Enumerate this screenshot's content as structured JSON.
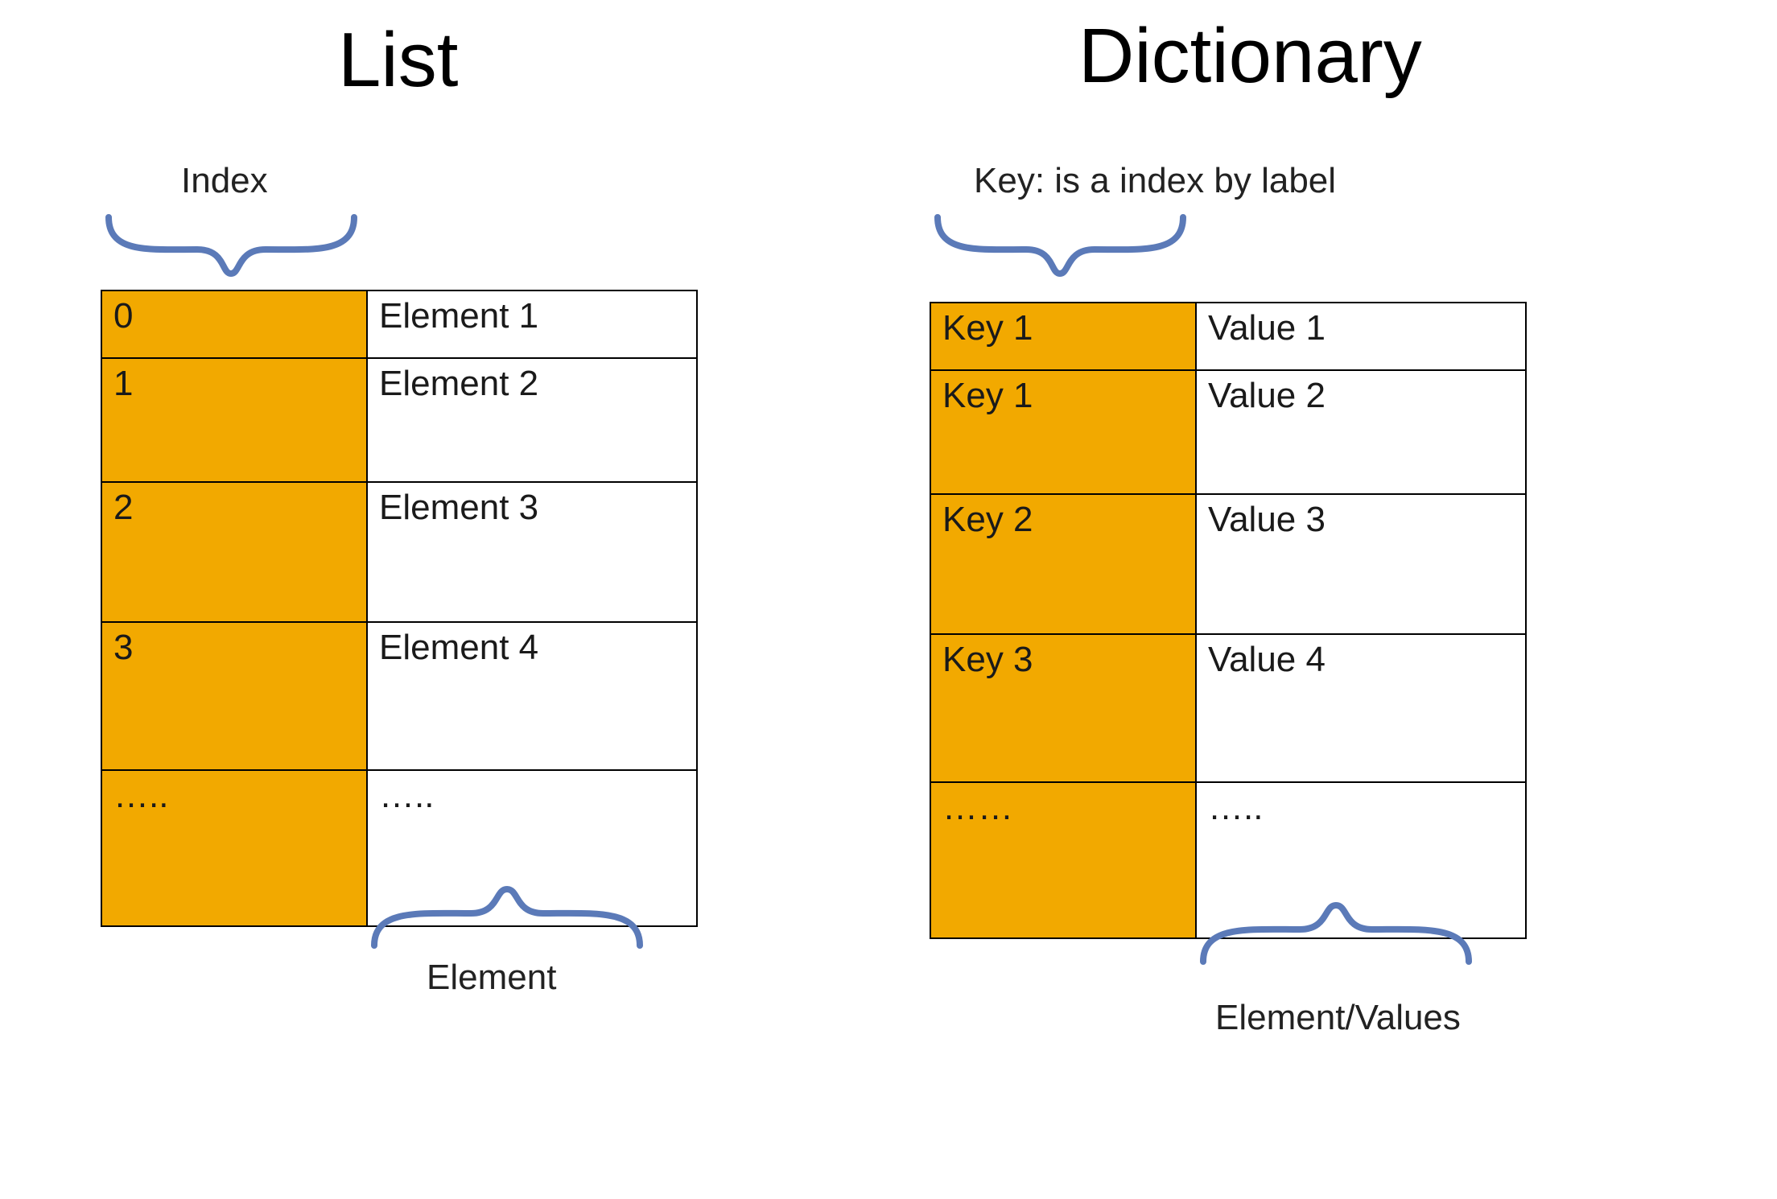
{
  "list": {
    "title": "List",
    "index_label": "Index",
    "element_label": "Element",
    "rows": [
      {
        "index": "0",
        "value": "Element  1"
      },
      {
        "index": "1",
        "value": "Element  2"
      },
      {
        "index": "2",
        "value": "Element  3"
      },
      {
        "index": "3",
        "value": "Element  4"
      },
      {
        "index": "…..",
        "value": "….."
      }
    ]
  },
  "dict": {
    "title": "Dictionary",
    "key_label": "Key: is a index by label",
    "value_label": "Element/Values",
    "rows": [
      {
        "key": "Key 1",
        "value": "Value  1"
      },
      {
        "key": "Key 1",
        "value": "Value  2"
      },
      {
        "key": "Key 2",
        "value": "Value 3"
      },
      {
        "key": "Key 3",
        "value": "Value  4"
      },
      {
        "key": "……",
        "value": "….."
      }
    ]
  },
  "colors": {
    "highlight": "#f2a900",
    "brace": "#5b7ab8"
  }
}
